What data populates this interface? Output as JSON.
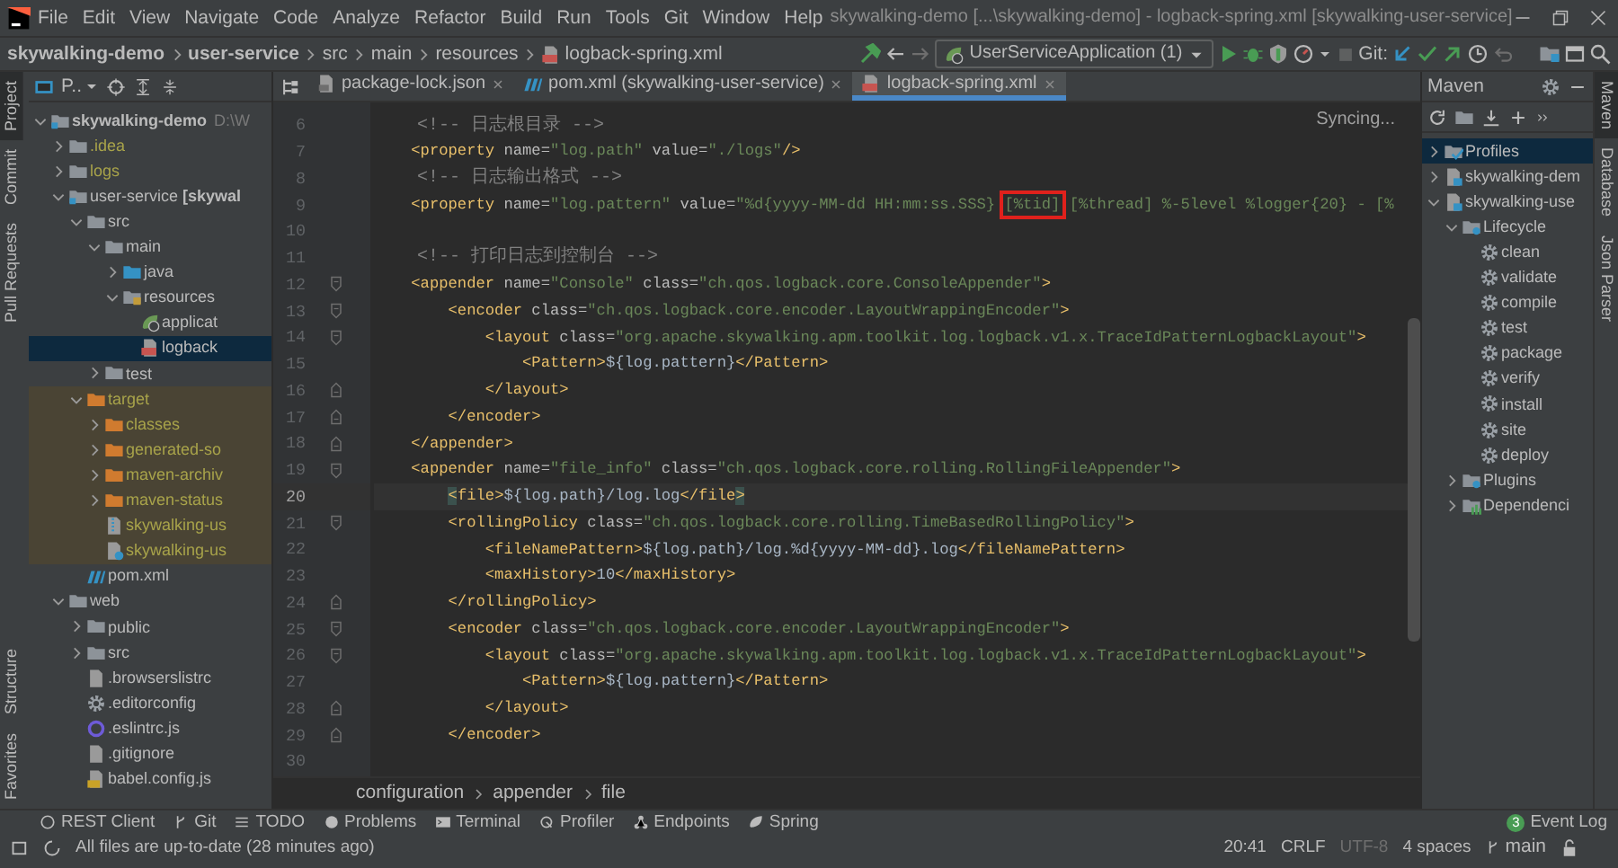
{
  "menu_bar": {
    "items": [
      "File",
      "Edit",
      "View",
      "Navigate",
      "Code",
      "Analyze",
      "Refactor",
      "Build",
      "Run",
      "Tools",
      "Git",
      "Window",
      "Help"
    ],
    "title": "skywalking-demo [...\\skywalking-demo] - logback-spring.xml [skywalking-user-service]"
  },
  "navigation_bar": {
    "breadcrumbs": [
      {
        "text": "skywalking-demo",
        "bold": true
      },
      {
        "text": "user-service",
        "bold": true
      },
      {
        "text": "src",
        "bold": false
      },
      {
        "text": "main",
        "bold": false
      },
      {
        "text": "resources",
        "bold": false
      },
      {
        "text": "logback-spring.xml",
        "bold": false
      }
    ],
    "run_configuration": "UserServiceApplication (1)",
    "vcs_label": "Git:"
  },
  "left_tool_strip": {
    "top": [
      {
        "label": "Project",
        "selected": true
      },
      {
        "label": "Commit",
        "selected": false
      },
      {
        "label": "Pull Requests",
        "selected": false
      }
    ],
    "bottom": [
      {
        "label": "Structure",
        "selected": false
      },
      {
        "label": "Favorites",
        "selected": false
      }
    ]
  },
  "project_panel": {
    "view_label": "P..",
    "tree": [
      {
        "text": "skywalking-demo",
        "bold": true,
        "hint": "D:\\W",
        "kind": "module",
        "expanded": true,
        "selected": false,
        "children": [
          {
            "text": ".idea",
            "kind": "folder",
            "expanded": false,
            "selected": false,
            "ignored": true
          },
          {
            "text": "logs",
            "kind": "folder",
            "expanded": false,
            "selected": false,
            "ignored": true
          },
          {
            "text": "user-service **[skywal**",
            "kind": "module",
            "expanded": true,
            "selected": false,
            "children": [
              {
                "text": "src",
                "kind": "folder",
                "expanded": true,
                "selected": false,
                "children": [
                  {
                    "text": "main",
                    "kind": "folder",
                    "expanded": true,
                    "selected": false,
                    "children": [
                      {
                        "text": "java",
                        "kind": "source-folder",
                        "expanded": false,
                        "selected": false
                      },
                      {
                        "text": "resources",
                        "kind": "resource-folder",
                        "expanded": true,
                        "selected": false,
                        "children": [
                          {
                            "text": "applicat",
                            "kind": "spring-file",
                            "selected": false
                          },
                          {
                            "text": "logback",
                            "kind": "xml-file",
                            "selected": true
                          }
                        ]
                      }
                    ]
                  },
                  {
                    "text": "test",
                    "kind": "folder",
                    "expanded": false,
                    "selected": false
                  }
                ]
              },
              {
                "text": "target",
                "kind": "excluded-folder",
                "expanded": true,
                "selected": false,
                "ignored": true,
                "excluded": true,
                "children": [
                  {
                    "text": "classes",
                    "kind": "excluded-folder",
                    "expanded": false,
                    "selected": false,
                    "ignored": true
                  },
                  {
                    "text": "generated-so",
                    "kind": "excluded-folder",
                    "expanded": false,
                    "selected": false,
                    "ignored": true
                  },
                  {
                    "text": "maven-archiv",
                    "kind": "excluded-folder",
                    "expanded": false,
                    "selected": false,
                    "ignored": true
                  },
                  {
                    "text": "maven-status",
                    "kind": "excluded-folder",
                    "expanded": false,
                    "selected": false,
                    "ignored": true
                  },
                  {
                    "text": "skywalking-us",
                    "kind": "jar-file",
                    "selected": false,
                    "ignored": true
                  },
                  {
                    "text": "skywalking-us",
                    "kind": "unknown-file",
                    "selected": false,
                    "ignored": true
                  }
                ]
              },
              {
                "text": "pom.xml",
                "kind": "maven-file",
                "selected": false
              }
            ]
          },
          {
            "text": "web",
            "kind": "folder",
            "expanded": true,
            "selected": false,
            "children": [
              {
                "text": "public",
                "kind": "folder",
                "expanded": false,
                "selected": false
              },
              {
                "text": "src",
                "kind": "folder",
                "expanded": false,
                "selected": false
              },
              {
                "text": ".browserslistrc",
                "kind": "text-file",
                "selected": false
              },
              {
                "text": ".editorconfig",
                "kind": "config-file",
                "selected": false
              },
              {
                "text": ".eslintrc.js",
                "kind": "eslint-file",
                "selected": false
              },
              {
                "text": ".gitignore",
                "kind": "text-file",
                "selected": false
              },
              {
                "text": "babel.config.js",
                "kind": "js-file",
                "selected": false
              }
            ]
          }
        ]
      }
    ]
  },
  "editor": {
    "tabs": [
      {
        "label": "package-lock.json",
        "kind": "json-file",
        "selected": false
      },
      {
        "label": "pom.xml (skywalking-user-service)",
        "kind": "maven-file",
        "selected": false
      },
      {
        "label": "logback-spring.xml",
        "kind": "xml-file",
        "selected": true
      }
    ],
    "status": "Syncing...",
    "lines": [
      {
        "number": "6",
        "current": false,
        "segments": [
          {
            "kind": "comment",
            "text": "    <!-- 日志根目录 -->"
          }
        ]
      },
      {
        "number": "7",
        "current": false,
        "segments": [
          {
            "kind": "tag",
            "text": "    <property"
          },
          {
            "kind": "attr",
            "text": " name="
          },
          {
            "kind": "value",
            "text": "\"log.path\""
          },
          {
            "kind": "attr",
            "text": " value="
          },
          {
            "kind": "value",
            "text": "\"./logs\""
          },
          {
            "kind": "tag",
            "text": "/>"
          }
        ]
      },
      {
        "number": "8",
        "current": false,
        "segments": [
          {
            "kind": "comment",
            "text": "    <!-- 日志输出格式 -->"
          }
        ]
      },
      {
        "number": "9",
        "current": false,
        "segments": [
          {
            "kind": "tag",
            "text": "    <property"
          },
          {
            "kind": "attr",
            "text": " name="
          },
          {
            "kind": "value",
            "text": "\"log.pattern\""
          },
          {
            "kind": "attr",
            "text": " value="
          },
          {
            "kind": "value",
            "text": "\"%d{yyyy-MM-dd HH:mm:ss.SSS} "
          },
          {
            "kind": "value",
            "text": "[%tid]",
            "boxed": true
          },
          {
            "kind": "value",
            "text": " [%thread] %-5level %logger{20} - [%"
          }
        ]
      },
      {
        "number": "10",
        "current": false
      },
      {
        "number": "11",
        "current": false,
        "segments": [
          {
            "kind": "comment",
            "text": "    <!-- 打印日志到控制台 -->"
          }
        ]
      },
      {
        "number": "12",
        "current": false,
        "fold_start": true,
        "segments": [
          {
            "kind": "tag",
            "text": "    <appender"
          },
          {
            "kind": "attr",
            "text": " name="
          },
          {
            "kind": "value",
            "text": "\"Console\""
          },
          {
            "kind": "attr",
            "text": " class="
          },
          {
            "kind": "value",
            "text": "\"ch.qos.logback.core.ConsoleAppender\""
          },
          {
            "kind": "tag",
            "text": ">"
          }
        ]
      },
      {
        "number": "13",
        "current": false,
        "fold_start": true,
        "segments": [
          {
            "kind": "tag",
            "text": "        <encoder"
          },
          {
            "kind": "attr",
            "text": " class="
          },
          {
            "kind": "value",
            "text": "\"ch.qos.logback.core.encoder.LayoutWrappingEncoder\""
          },
          {
            "kind": "tag",
            "text": ">"
          }
        ]
      },
      {
        "number": "14",
        "current": false,
        "fold_start": true,
        "segments": [
          {
            "kind": "tag",
            "text": "            <layout"
          },
          {
            "kind": "attr",
            "text": " class="
          },
          {
            "kind": "value",
            "text": "\"org.apache.skywalking.apm.toolkit.log.logback.v1.x.TraceIdPatternLogbackLayout\""
          },
          {
            "kind": "tag",
            "text": ">"
          }
        ]
      },
      {
        "number": "15",
        "current": false,
        "segments": [
          {
            "kind": "tag",
            "text": "                <Pattern>"
          },
          {
            "kind": "text",
            "text": "${log.pattern}"
          },
          {
            "kind": "tag",
            "text": "</Pattern>"
          }
        ]
      },
      {
        "number": "16",
        "current": false,
        "fold_end": true,
        "segments": [
          {
            "kind": "tag",
            "text": "            </layout>"
          }
        ]
      },
      {
        "number": "17",
        "current": false,
        "fold_end": true,
        "segments": [
          {
            "kind": "tag",
            "text": "        </encoder>"
          }
        ]
      },
      {
        "number": "18",
        "current": false,
        "fold_end": true,
        "segments": [
          {
            "kind": "tag",
            "text": "    </appender>"
          }
        ]
      },
      {
        "number": "19",
        "current": false,
        "fold_start": true,
        "segments": [
          {
            "kind": "tag",
            "text": "    <appender"
          },
          {
            "kind": "attr",
            "text": " name="
          },
          {
            "kind": "value",
            "text": "\"file_info\""
          },
          {
            "kind": "attr",
            "text": " class="
          },
          {
            "kind": "value",
            "text": "\"ch.qos.logback.core.rolling.RollingFileAppender\""
          },
          {
            "kind": "tag",
            "text": ">"
          }
        ]
      },
      {
        "number": "20",
        "current": true,
        "segments": [
          {
            "kind": "tag",
            "text": "        <",
            "matched": true
          },
          {
            "kind": "tag",
            "text": "file>"
          },
          {
            "kind": "text",
            "text": "${log.path}/log.log"
          },
          {
            "kind": "tag",
            "text": "</file"
          },
          {
            "kind": "tag",
            "text": ">",
            "matched": true
          }
        ]
      },
      {
        "number": "21",
        "current": false,
        "fold_start": true,
        "segments": [
          {
            "kind": "tag",
            "text": "        <rollingPolicy"
          },
          {
            "kind": "attr",
            "text": " class="
          },
          {
            "kind": "value",
            "text": "\"ch.qos.logback.core.rolling.TimeBasedRollingPolicy\""
          },
          {
            "kind": "tag",
            "text": ">"
          }
        ]
      },
      {
        "number": "22",
        "current": false,
        "segments": [
          {
            "kind": "tag",
            "text": "            <fileNamePattern>"
          },
          {
            "kind": "text",
            "text": "${log.path}/log.%d{yyyy-MM-dd}.log"
          },
          {
            "kind": "tag",
            "text": "</fileNamePattern>"
          }
        ]
      },
      {
        "number": "23",
        "current": false,
        "segments": [
          {
            "kind": "tag",
            "text": "            <maxHistory>"
          },
          {
            "kind": "text",
            "text": "10"
          },
          {
            "kind": "tag",
            "text": "</maxHistory>"
          }
        ]
      },
      {
        "number": "24",
        "current": false,
        "fold_end": true,
        "segments": [
          {
            "kind": "tag",
            "text": "        </rollingPolicy>"
          }
        ]
      },
      {
        "number": "25",
        "current": false,
        "fold_start": true,
        "segments": [
          {
            "kind": "tag",
            "text": "        <encoder"
          },
          {
            "kind": "attr",
            "text": " class="
          },
          {
            "kind": "value",
            "text": "\"ch.qos.logback.core.encoder.LayoutWrappingEncoder\""
          },
          {
            "kind": "tag",
            "text": ">"
          }
        ]
      },
      {
        "number": "26",
        "current": false,
        "fold_start": true,
        "segments": [
          {
            "kind": "tag",
            "text": "            <layout"
          },
          {
            "kind": "attr",
            "text": " class="
          },
          {
            "kind": "value",
            "text": "\"org.apache.skywalking.apm.toolkit.log.logback.v1.x.TraceIdPatternLogbackLayout\""
          },
          {
            "kind": "tag",
            "text": ">"
          }
        ]
      },
      {
        "number": "27",
        "current": false,
        "segments": [
          {
            "kind": "tag",
            "text": "                <Pattern>"
          },
          {
            "kind": "text",
            "text": "${log.pattern}"
          },
          {
            "kind": "tag",
            "text": "</Pattern>"
          }
        ]
      },
      {
        "number": "28",
        "current": false,
        "fold_end": true,
        "segments": [
          {
            "kind": "tag",
            "text": "            </layout>"
          }
        ]
      },
      {
        "number": "29",
        "current": false,
        "fold_end": true,
        "segments": [
          {
            "kind": "tag",
            "text": "        </encoder>"
          }
        ]
      },
      {
        "number": "30",
        "current": false
      }
    ],
    "breadcrumbs": [
      "configuration",
      "appender",
      "file"
    ]
  },
  "maven_panel": {
    "title": "Maven",
    "tree": [
      {
        "text": "Profiles",
        "kind": "profiles",
        "expanded": false,
        "selected": true
      },
      {
        "text": "skywalking-dem",
        "kind": "maven-project",
        "expanded": false,
        "selected": false
      },
      {
        "text": "skywalking-use",
        "kind": "maven-project",
        "expanded": true,
        "selected": false,
        "children": [
          {
            "text": "Lifecycle",
            "kind": "lifecycle",
            "expanded": true,
            "selected": false,
            "children": [
              {
                "text": "clean",
                "kind": "goal",
                "selected": false
              },
              {
                "text": "validate",
                "kind": "goal",
                "selected": false
              },
              {
                "text": "compile",
                "kind": "goal",
                "selected": false
              },
              {
                "text": "test",
                "kind": "goal",
                "selected": false
              },
              {
                "text": "package",
                "kind": "goal",
                "selected": false
              },
              {
                "text": "verify",
                "kind": "goal",
                "selected": false
              },
              {
                "text": "install",
                "kind": "goal",
                "selected": false
              },
              {
                "text": "site",
                "kind": "goal",
                "selected": false
              },
              {
                "text": "deploy",
                "kind": "goal",
                "selected": false
              }
            ]
          },
          {
            "text": "Plugins",
            "kind": "lifecycle",
            "expanded": false,
            "selected": false
          },
          {
            "text": "Dependenci",
            "kind": "dependencies",
            "expanded": false,
            "selected": false
          }
        ]
      }
    ]
  },
  "right_tool_strip": [
    {
      "label": "Maven",
      "selected": true
    },
    {
      "label": "Database",
      "selected": false
    },
    {
      "label": "Json Parser",
      "selected": false
    }
  ],
  "tool_window_bar": {
    "items": [
      {
        "label": "REST Client",
        "kind": "rest"
      },
      {
        "label": "Git",
        "kind": "git"
      },
      {
        "label": "TODO",
        "kind": "todo"
      },
      {
        "label": "Problems",
        "kind": "problems"
      },
      {
        "label": "Terminal",
        "kind": "terminal"
      },
      {
        "label": "Profiler",
        "kind": "profiler"
      },
      {
        "label": "Endpoints",
        "kind": "endpoints"
      },
      {
        "label": "Spring",
        "kind": "spring"
      }
    ],
    "event_log": {
      "count": "3",
      "label": "Event Log"
    }
  },
  "status_bar": {
    "message": "All files are up-to-date (28 minutes ago)",
    "position": "20:41",
    "line_separator": "CRLF",
    "encoding": "UTF-8",
    "encoding_disabled": true,
    "indent": "4 spaces",
    "branch": "main"
  }
}
